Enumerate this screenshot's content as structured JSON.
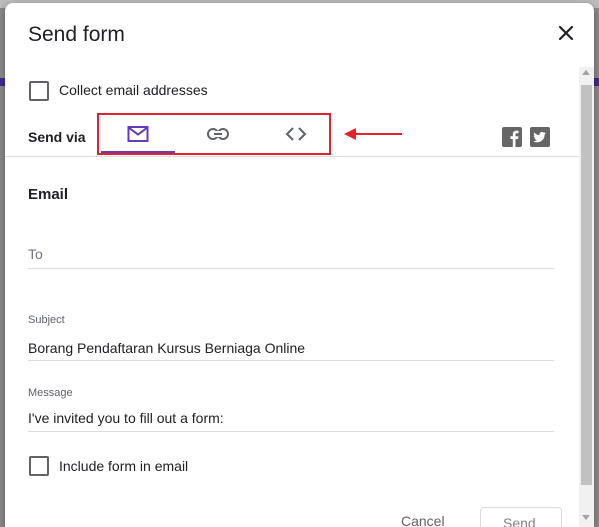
{
  "dialog": {
    "title": "Send form",
    "close_icon": "close-icon"
  },
  "collect_email": {
    "label": "Collect email addresses",
    "checked": false
  },
  "send_via": {
    "label": "Send via",
    "tabs": [
      {
        "icon": "email-icon",
        "selected": true
      },
      {
        "icon": "link-icon",
        "selected": false
      },
      {
        "icon": "embed-code-icon",
        "selected": false
      }
    ],
    "highlight_color": "#e0242b",
    "accent_color": "#673ab7",
    "share": [
      {
        "icon": "facebook-icon"
      },
      {
        "icon": "twitter-icon"
      }
    ]
  },
  "email": {
    "section_title": "Email",
    "to_placeholder": "To",
    "subject_label": "Subject",
    "subject_value": "Borang Pendaftaran Kursus Berniaga Online",
    "message_label": "Message",
    "message_value": "I've invited you to fill out a form:",
    "include_form_label": "Include form in email",
    "include_form_checked": false
  },
  "footer": {
    "cancel_label": "Cancel",
    "send_label": "Send"
  }
}
